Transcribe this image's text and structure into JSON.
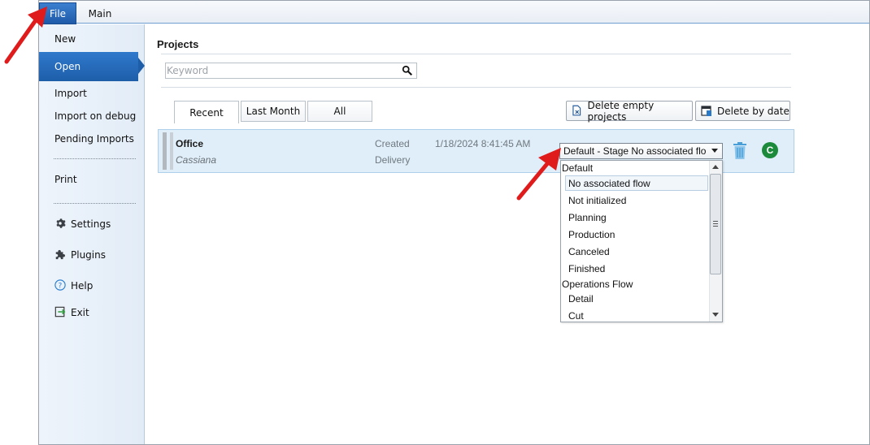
{
  "menubar": {
    "file_label": "File",
    "main_label": "Main"
  },
  "sidebar": {
    "items": [
      {
        "label": "New"
      },
      {
        "label": "Open"
      },
      {
        "label": "Import"
      },
      {
        "label": "Import on debug"
      },
      {
        "label": "Pending Imports"
      },
      {
        "label": "Print"
      },
      {
        "label": "Settings",
        "icon": "gear-icon"
      },
      {
        "label": "Plugins",
        "icon": "puzzle-icon"
      },
      {
        "label": "Help",
        "icon": "help-icon"
      },
      {
        "label": "Exit",
        "icon": "exit-icon"
      }
    ]
  },
  "projects": {
    "title": "Projects",
    "search": {
      "placeholder": "Keyword",
      "value": ""
    },
    "tabs": [
      {
        "label": "Recent"
      },
      {
        "label": "Last Month"
      },
      {
        "label": "All"
      }
    ],
    "actions": {
      "delete_empty": "Delete empty projects",
      "delete_by_date": "Delete by date"
    },
    "rows": [
      {
        "name": "Office",
        "client": "Cassiana",
        "created_label": "Created",
        "delivery_label": "Delivery",
        "created_date": "1/18/2024 8:41:45 AM",
        "stage_value": "Default - Stage No associated flo",
        "badge": "C"
      }
    ]
  },
  "dropdown": {
    "groups": [
      {
        "label": "Default",
        "options": [
          "No associated flow",
          "Not initialized",
          "Planning",
          "Production",
          "Canceled",
          "Finished"
        ]
      },
      {
        "label": "Operations Flow",
        "options": [
          "Detail",
          "Cut"
        ]
      }
    ],
    "selected": "No associated flow"
  },
  "colors": {
    "accent": "#1e5ea9",
    "row_highlight": "#dfeef9",
    "badge_green": "#1c8a3b",
    "trash_blue": "#4a9fd8",
    "annotation_red": "#e01b1b"
  }
}
